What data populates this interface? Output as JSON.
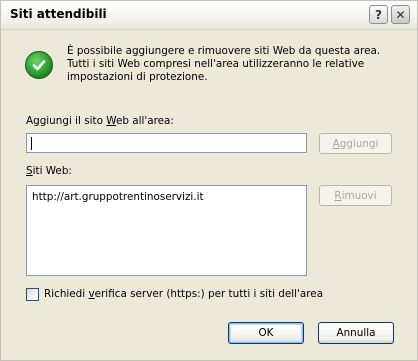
{
  "window": {
    "title": "Siti attendibili"
  },
  "titlebar": {
    "help_glyph": "?",
    "close_glyph": "✕"
  },
  "info": {
    "icon": "checkmark-icon",
    "line1": "È possibile aggiungere e rimuovere siti Web da questa area.",
    "line2": "Tutti i siti Web compresi nell'area utilizzeranno le relative",
    "line3": "impostazioni di protezione."
  },
  "add_site": {
    "label_pre": "Aggiungi il sito ",
    "label_key": "W",
    "label_post": "eb all'area:",
    "value": "",
    "button_key": "A",
    "button_rest": "ggiungi"
  },
  "sites": {
    "label_key": "S",
    "label_rest": "iti Web:",
    "items": [
      "http://art.gruppotrentinoservizi.it"
    ],
    "remove_key": "R",
    "remove_rest": "imuovi"
  },
  "require_https": {
    "label_pre": "Richiedi ",
    "label_key": "v",
    "label_post": "erifica server (https:) per tutti i siti dell'area",
    "checked": false
  },
  "footer": {
    "ok": "OK",
    "cancel": "Annulla"
  }
}
